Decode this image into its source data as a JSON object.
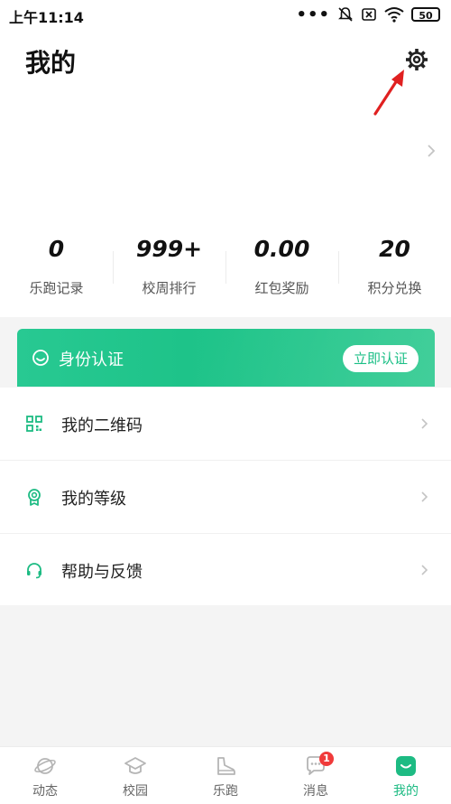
{
  "status_bar": {
    "time": "上午11:14",
    "battery": "50"
  },
  "header": {
    "title": "我的"
  },
  "stats": [
    {
      "value": "0",
      "label": "乐跑记录"
    },
    {
      "value": "999+",
      "label": "校周排行"
    },
    {
      "value": "0.00",
      "label": "红包奖励"
    },
    {
      "value": "20",
      "label": "积分兑换"
    }
  ],
  "verify": {
    "label": "身份认证",
    "button": "立即认证"
  },
  "menu": [
    {
      "label": "我的二维码",
      "icon": "qrcode-icon"
    },
    {
      "label": "我的等级",
      "icon": "medal-icon"
    },
    {
      "label": "帮助与反馈",
      "icon": "headset-icon"
    }
  ],
  "tabs": [
    {
      "label": "动态",
      "icon": "planet-icon"
    },
    {
      "label": "校园",
      "icon": "graduation-cap-icon"
    },
    {
      "label": "乐跑",
      "icon": "sneaker-icon"
    },
    {
      "label": "消息",
      "icon": "chat-icon",
      "badge": "1"
    },
    {
      "label": "我的",
      "icon": "profile-icon",
      "active": true
    }
  ],
  "colors": {
    "accent": "#1dbb83",
    "badge": "#f03a3a",
    "arrow": "#e02020"
  }
}
